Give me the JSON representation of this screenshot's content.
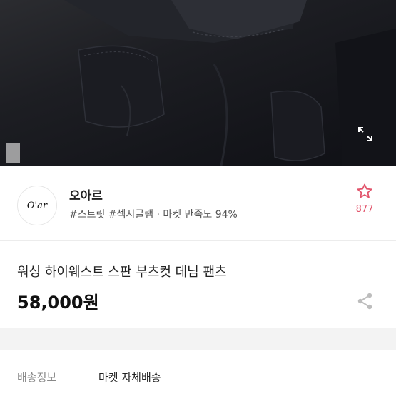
{
  "seller": {
    "logo_text": "O'ar",
    "name": "오아르",
    "meta": "#스트릿 #섹시글램 · 마켓 만족도 94%",
    "favorite_count": "877"
  },
  "product": {
    "title": "워싱 하이웨스트 스판 부츠컷 데님 팬츠",
    "price": "58,000원"
  },
  "shipping": {
    "label": "배송정보",
    "value": "마켓 자체배송"
  },
  "colors": {
    "accent": "#e2546b",
    "denim": "#1a1b20"
  },
  "icons": {
    "expand": "expand-icon",
    "favorite": "star-icon",
    "share": "share-icon"
  }
}
